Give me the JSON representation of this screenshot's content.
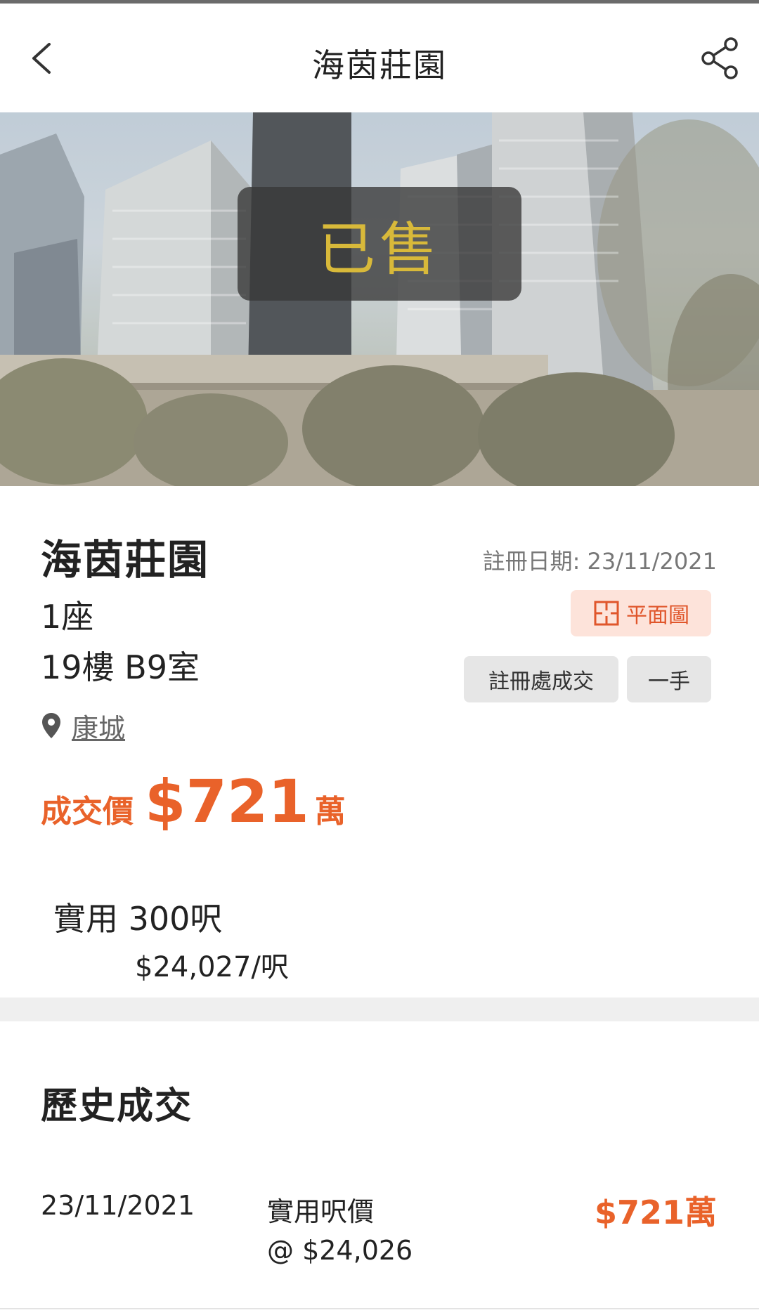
{
  "header": {
    "title": "海茵莊園",
    "back_icon": "chevron-left-icon",
    "share_icon": "share-icon"
  },
  "hero": {
    "status_badge": "已售"
  },
  "listing": {
    "estate_name": "海茵莊園",
    "block": "1座",
    "unit": "19樓 B9室",
    "registration_date": "註冊日期: 23/11/2021",
    "floorplan_label": "平面圖",
    "tags": [
      "註冊處成交",
      "一手"
    ],
    "district": "康城",
    "price_label": "成交價",
    "price_value": "$721",
    "price_unit": "萬",
    "saleable_area": "實用 300呎",
    "price_per_ft": "$24,027/呎"
  },
  "history": {
    "title": "歷史成交",
    "rows": [
      {
        "date": "23/11/2021",
        "label": "實用呎價",
        "psf": "@ $24,026",
        "price": "$721萬"
      }
    ]
  },
  "colors": {
    "accent": "#e9622a",
    "sold_text": "#d8b93a",
    "tag_bg": "#e6e6e6",
    "floorplan_bg": "#fde3da"
  }
}
